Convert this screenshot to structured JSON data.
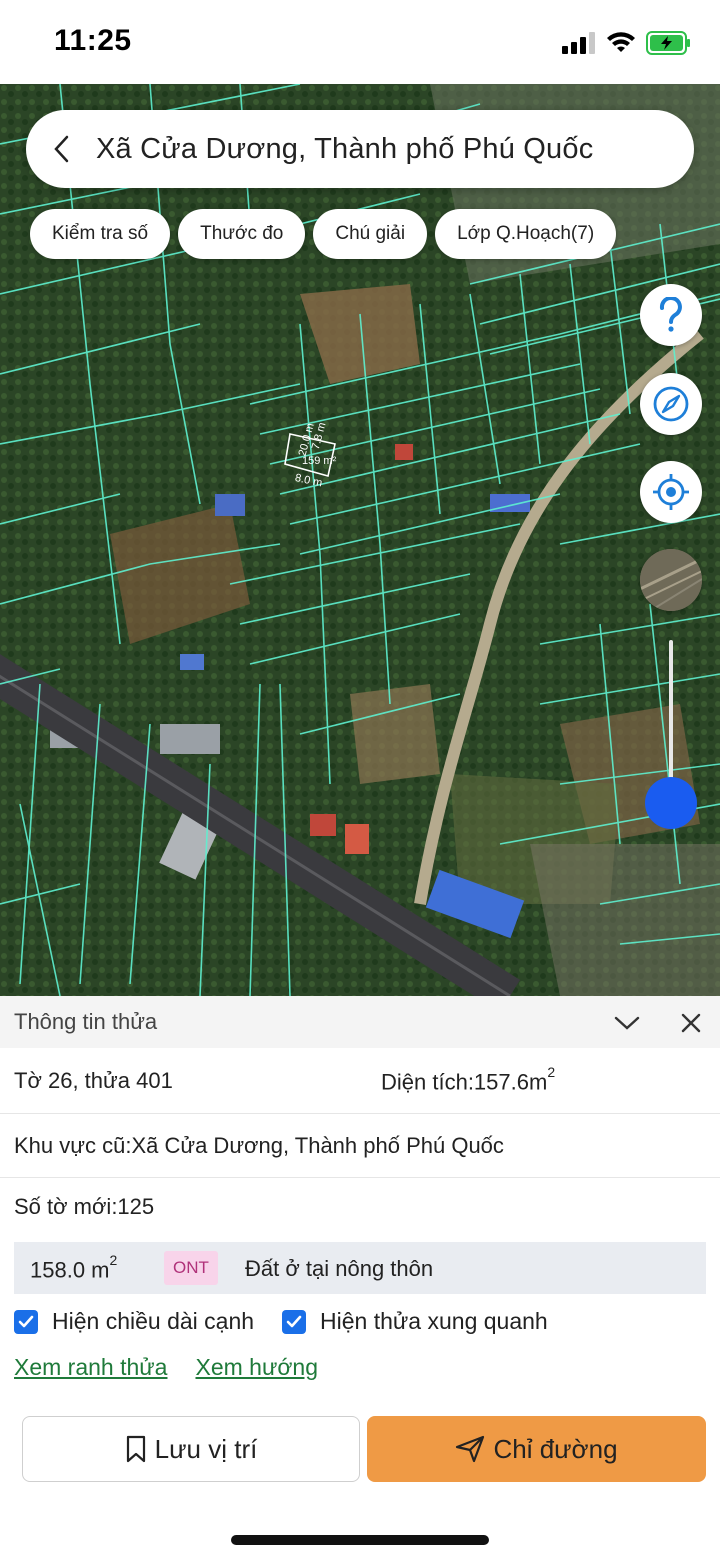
{
  "status_bar": {
    "time": "11:25",
    "icons": [
      "signal-icon",
      "wifi-icon",
      "battery-charging-icon"
    ]
  },
  "search": {
    "title": "Xã Cửa Dương, Thành phố Phú Quốc"
  },
  "chips": [
    {
      "label": "Kiểm tra số"
    },
    {
      "label": "Thước đo"
    },
    {
      "label": "Chú giải"
    },
    {
      "label": "Lớp Q.Hoạch(7)"
    }
  ],
  "map": {
    "parcel_labels": {
      "side_top": "20.0 m",
      "side_left": "7.8 m",
      "area": "159 m²",
      "side_bottom": "8.0 m"
    },
    "buttons": [
      "help-icon",
      "compass-icon",
      "locate-icon",
      "layer-thumbnail"
    ],
    "zoom_level": 0.9
  },
  "panel": {
    "title": "Thông tin thửa",
    "sheet_parcel": "Tờ 26, thửa 401",
    "area_label": "Diện tích:157.6m",
    "area_sup": "2",
    "old_area": "Khu vực cũ:Xã Cửa Dương, Thành phố Phú Quốc",
    "new_sheet": "Số tờ mới:125",
    "land_area": "158.0 m",
    "land_area_sup": "2",
    "land_code": "ONT",
    "land_type": "Đất ở tại nông thôn",
    "check_edge": "Hiện chiều dài cạnh",
    "check_neighbors": "Hiện thửa xung quanh",
    "link_boundary": "Xem ranh thửa",
    "link_direction": "Xem hướng",
    "save_label": "Lưu vị trí",
    "directions_label": "Chỉ đường"
  },
  "colors": {
    "accent_orange": "#ef9a45",
    "checkbox_blue": "#1a6fe8",
    "link_green": "#1f7a3a",
    "parcel_line": "#5ef0d0"
  }
}
